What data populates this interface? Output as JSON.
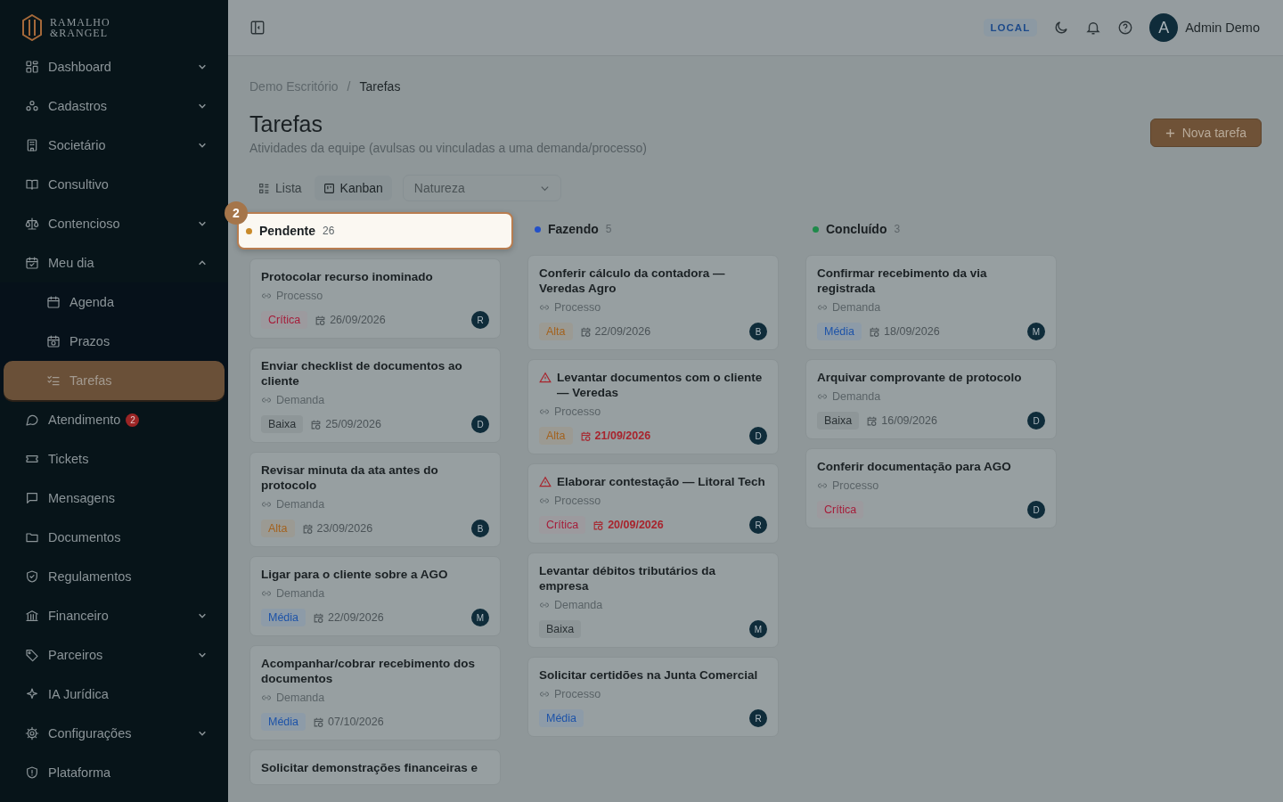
{
  "brand": {
    "line_1": "RAMALHO",
    "line_2": "&RANGEL"
  },
  "sidebar": {
    "items": [
      {
        "label": "Dashboard",
        "kind": "group",
        "expanded": false,
        "selected": false
      },
      {
        "label": "Cadastros",
        "kind": "group",
        "expanded": false,
        "selected": false
      },
      {
        "label": "Societário",
        "kind": "group",
        "expanded": false,
        "selected": false
      },
      {
        "label": "Consultivo",
        "kind": "link",
        "selected": false
      },
      {
        "label": "Contencioso",
        "kind": "group",
        "expanded": false,
        "selected": false
      },
      {
        "label": "Meu dia",
        "kind": "group",
        "expanded": true,
        "selected": false,
        "children": [
          {
            "label": "Agenda",
            "selected": false
          },
          {
            "label": "Prazos",
            "selected": false
          },
          {
            "label": "Tarefas",
            "selected": true
          }
        ]
      },
      {
        "label": "Atendimento",
        "kind": "link",
        "badge": "2",
        "selected": false
      },
      {
        "label": "Tickets",
        "kind": "link",
        "selected": false
      },
      {
        "label": "Mensagens",
        "kind": "link",
        "selected": false
      },
      {
        "label": "Documentos",
        "kind": "link",
        "selected": false
      },
      {
        "label": "Regulamentos",
        "kind": "link",
        "selected": false
      },
      {
        "label": "Financeiro",
        "kind": "group",
        "expanded": false,
        "selected": false
      },
      {
        "label": "Parceiros",
        "kind": "group",
        "expanded": false,
        "selected": false
      },
      {
        "label": "IA Jurídica",
        "kind": "link",
        "selected": false
      },
      {
        "label": "Configurações",
        "kind": "group",
        "expanded": false,
        "selected": false
      },
      {
        "label": "Plataforma",
        "kind": "link",
        "selected": false
      }
    ]
  },
  "header": {
    "environment": "LOCAL",
    "user": {
      "initial": "A",
      "name": "Admin Demo"
    }
  },
  "breadcrumb": {
    "items": [
      "Demo Escritório",
      "Tarefas"
    ],
    "separator": "/"
  },
  "page": {
    "title": "Tarefas",
    "subtitle": "Atividades da equipe (avulsas ou vinculadas a uma demanda/processo)",
    "new_button": "Nova tarefa"
  },
  "view_tabs": [
    {
      "label": "Lista",
      "selected": false
    },
    {
      "label": "Kanban",
      "selected": true
    }
  ],
  "filter": {
    "placeholder": "Natureza"
  },
  "tour": {
    "step": "2"
  },
  "columns": [
    {
      "name": "Pendente",
      "count": "26",
      "color": "#c98a2a",
      "spotlight": true,
      "cards": [
        {
          "title": "Protocolar recurso inominado",
          "warning": false,
          "link": "Processo",
          "priority": "Crítica",
          "kind": "critical",
          "date": "26/09/2026",
          "overdue": false,
          "assignee": "R"
        },
        {
          "title": "Enviar checklist de documentos ao cliente",
          "warning": false,
          "link": "Demanda",
          "priority": "Baixa",
          "kind": "low",
          "date": "25/09/2026",
          "overdue": false,
          "assignee": "D"
        },
        {
          "title": "Revisar minuta da ata antes do protocolo",
          "warning": false,
          "link": "Demanda",
          "priority": "Alta",
          "kind": "high",
          "date": "23/09/2026",
          "overdue": false,
          "assignee": "B"
        },
        {
          "title": "Ligar para o cliente sobre a AGO",
          "warning": false,
          "link": "Demanda",
          "priority": "Média",
          "kind": "medium",
          "date": "22/09/2026",
          "overdue": false,
          "assignee": "M"
        },
        {
          "title": "Acompanhar/cobrar recebimento dos documentos",
          "warning": false,
          "link": "Demanda",
          "priority": "Média",
          "kind": "medium",
          "date": "07/10/2026",
          "overdue": false
        },
        {
          "title": "Solicitar demonstrações financeiras e",
          "warning": false
        }
      ]
    },
    {
      "name": "Fazendo",
      "count": "5",
      "color": "#2350c8",
      "spotlight": false,
      "cards": [
        {
          "title": "Conferir cálculo da contadora — Veredas Agro",
          "warning": false,
          "link": "Processo",
          "priority": "Alta",
          "kind": "high",
          "date": "22/09/2026",
          "overdue": false,
          "assignee": "B"
        },
        {
          "title": "Levantar documentos com o cliente — Veredas",
          "warning": true,
          "link": "Processo",
          "priority": "Alta",
          "kind": "high",
          "date": "21/09/2026",
          "overdue": true,
          "assignee": "D"
        },
        {
          "title": "Elaborar contestação — Litoral Tech",
          "warning": true,
          "link": "Processo",
          "priority": "Crítica",
          "kind": "critical",
          "date": "20/09/2026",
          "overdue": true,
          "assignee": "R"
        },
        {
          "title": "Levantar débitos tributários da empresa",
          "warning": false,
          "link": "Demanda",
          "priority": "Baixa",
          "kind": "low",
          "assignee": "M"
        },
        {
          "title": "Solicitar certidões na Junta Comercial",
          "warning": false,
          "link": "Processo",
          "priority": "Média",
          "kind": "medium",
          "assignee": "R"
        }
      ]
    },
    {
      "name": "Concluído",
      "count": "3",
      "color": "#1f8a4a",
      "spotlight": false,
      "cards": [
        {
          "title": "Confirmar recebimento da via registrada",
          "warning": false,
          "link": "Demanda",
          "priority": "Média",
          "kind": "medium",
          "date": "18/09/2026",
          "overdue": false,
          "assignee": "M"
        },
        {
          "title": "Arquivar comprovante de protocolo",
          "warning": false,
          "link": "Demanda",
          "priority": "Baixa",
          "kind": "low",
          "date": "16/09/2026",
          "overdue": false,
          "assignee": "D"
        },
        {
          "title": "Conferir documentação para AGO",
          "warning": false,
          "link": "Processo",
          "priority": "Crítica",
          "kind": "critical",
          "assignee": "D"
        }
      ]
    }
  ]
}
